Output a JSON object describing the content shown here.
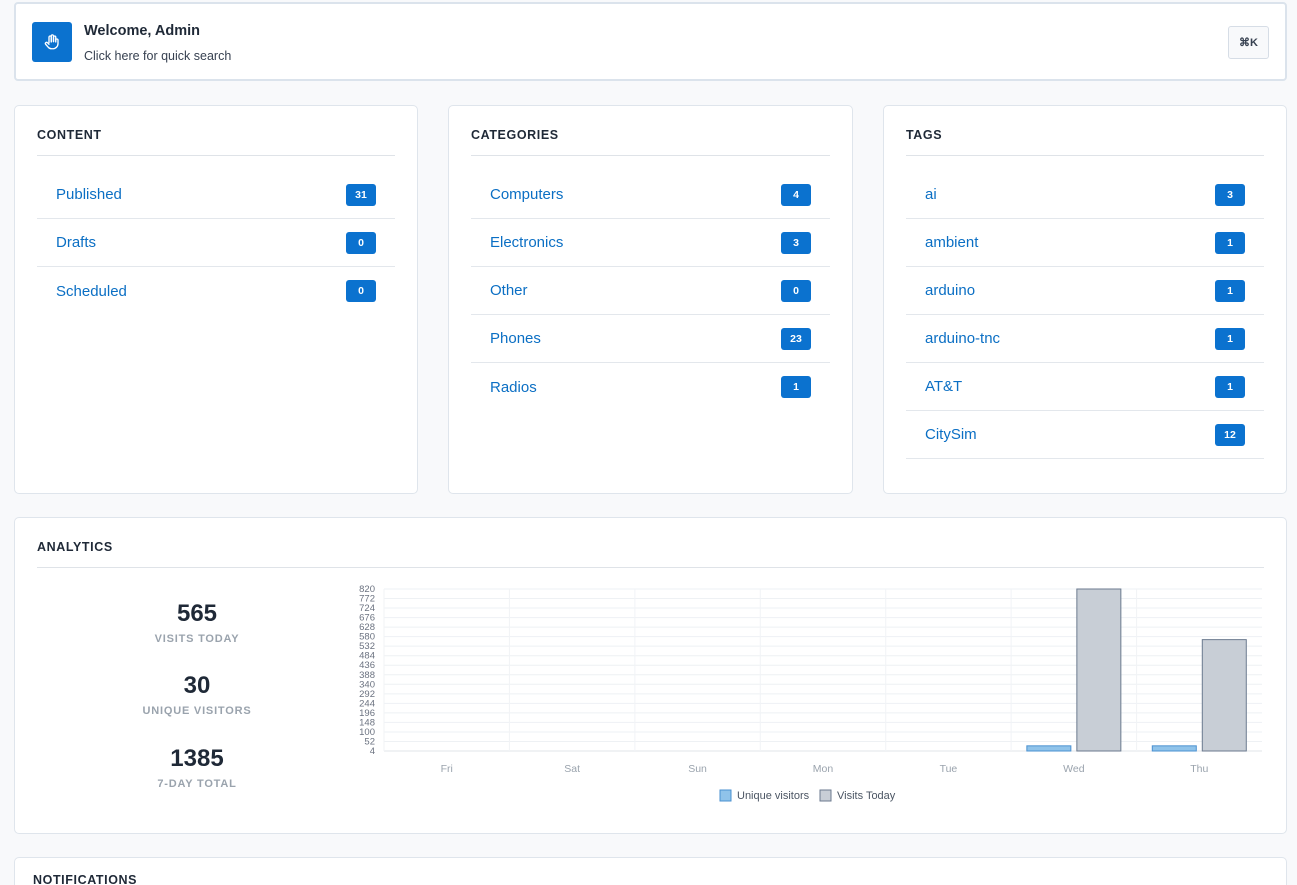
{
  "welcome": {
    "title": "Welcome, Admin",
    "subtitle": "Click here for quick search",
    "shortcut": "⌘K",
    "icon": "hand-wave-icon"
  },
  "content": {
    "title": "CONTENT",
    "items": [
      {
        "label": "Published",
        "count": "31"
      },
      {
        "label": "Drafts",
        "count": "0"
      },
      {
        "label": "Scheduled",
        "count": "0"
      }
    ]
  },
  "categories": {
    "title": "CATEGORIES",
    "items": [
      {
        "label": "Computers",
        "count": "4"
      },
      {
        "label": "Electronics",
        "count": "3"
      },
      {
        "label": "Other",
        "count": "0"
      },
      {
        "label": "Phones",
        "count": "23"
      },
      {
        "label": "Radios",
        "count": "1"
      }
    ]
  },
  "tags": {
    "title": "TAGS",
    "items": [
      {
        "label": "ai",
        "count": "3"
      },
      {
        "label": "ambient",
        "count": "1"
      },
      {
        "label": "arduino",
        "count": "1"
      },
      {
        "label": "arduino-tnc",
        "count": "1"
      },
      {
        "label": "AT&T",
        "count": "1"
      },
      {
        "label": "CitySim",
        "count": "12"
      }
    ]
  },
  "analytics": {
    "title": "ANALYTICS",
    "stats": [
      {
        "value": "565",
        "label": "VISITS TODAY"
      },
      {
        "value": "30",
        "label": "UNIQUE VISITORS"
      },
      {
        "value": "1385",
        "label": "7-DAY TOTAL"
      }
    ]
  },
  "notifications": {
    "title": "NOTIFICATIONS"
  },
  "colors": {
    "accent": "#0b72cf",
    "link": "#0b6fc4",
    "unique_fill": "#8fc3ea",
    "unique_stroke": "#4a90d0",
    "visits_fill": "#c8ced6",
    "visits_stroke": "#6b7a8f"
  },
  "chart_data": {
    "type": "bar",
    "categories": [
      "Fri",
      "Sat",
      "Sun",
      "Mon",
      "Tue",
      "Wed",
      "Thu"
    ],
    "series": [
      {
        "name": "Unique visitors",
        "values": [
          0,
          0,
          0,
          0,
          0,
          30,
          30
        ]
      },
      {
        "name": "Visits Today",
        "values": [
          0,
          0,
          0,
          0,
          0,
          820,
          565
        ]
      }
    ],
    "yticks": [
      4,
      52,
      100,
      148,
      196,
      244,
      292,
      340,
      388,
      436,
      484,
      532,
      580,
      628,
      676,
      724,
      772,
      820
    ],
    "ylim": [
      4,
      820
    ],
    "grid": true,
    "legend": "bottom"
  }
}
